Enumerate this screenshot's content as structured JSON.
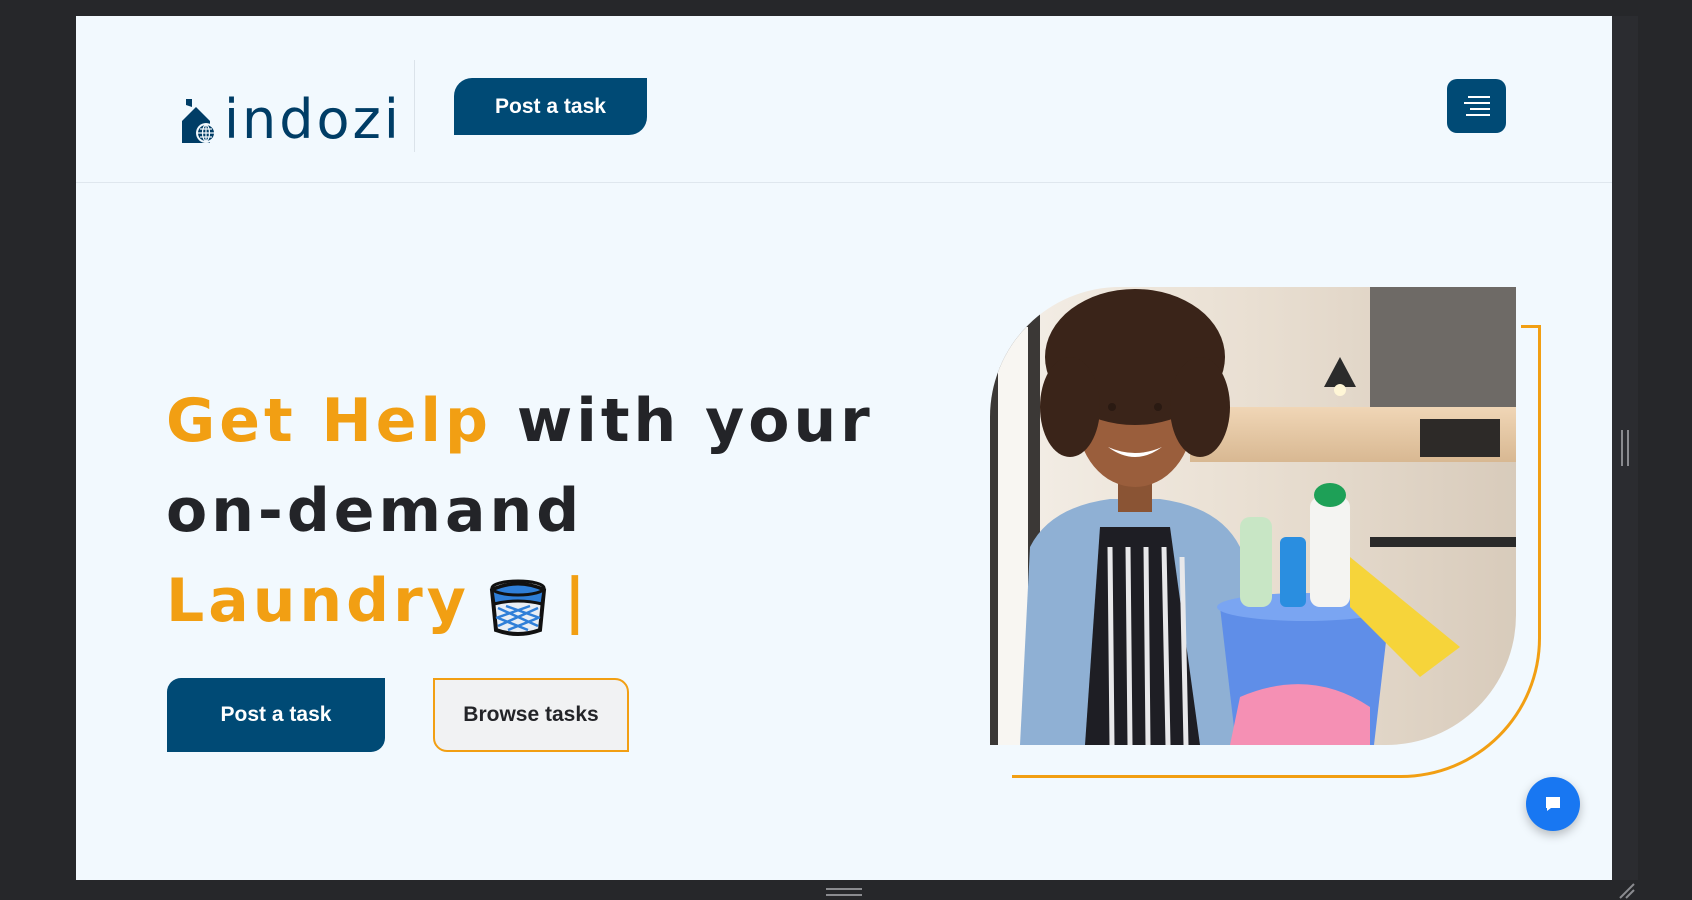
{
  "brand": {
    "name": "indozi",
    "primary_color": "#004a75",
    "accent_color": "#f29f13",
    "icon": "house-globe-icon"
  },
  "header": {
    "post_task_label": "Post a task",
    "menu_icon": "menu-icon"
  },
  "hero": {
    "title_highlight": "Get Help",
    "title_rest_line1": " with your",
    "title_line2": "on-demand",
    "title_service": "Laundry",
    "title_emoji": "laundry-basket-emoji",
    "title_caret": "|",
    "primary_button": "Post a task",
    "secondary_button": "Browse tasks",
    "image": "woman-holding-cleaning-bucket-photo"
  },
  "chat": {
    "icon": "chat-bubble-icon",
    "color": "#1877f2"
  }
}
